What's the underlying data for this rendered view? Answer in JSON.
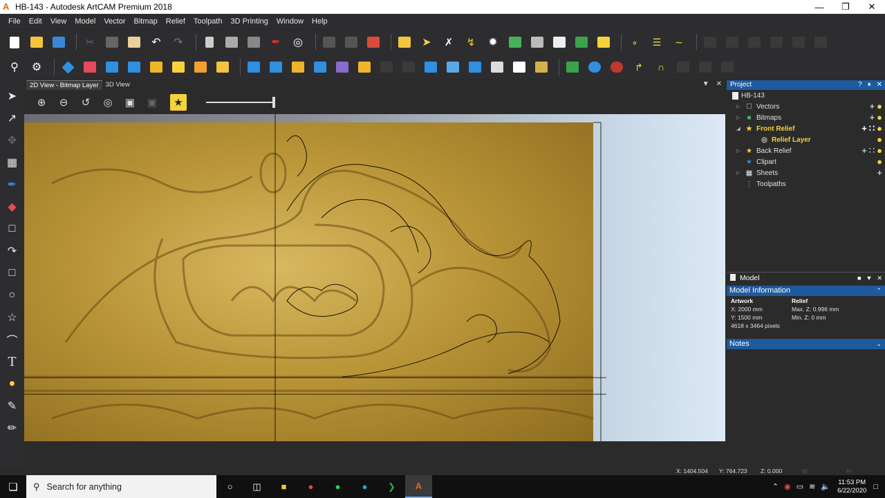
{
  "window": {
    "title": "HB-143 - Autodesk ArtCAM Premium 2018",
    "app_icon": "artcam-logo-icon"
  },
  "menu": [
    "File",
    "Edit",
    "View",
    "Model",
    "Vector",
    "Bitmap",
    "Relief",
    "Toolpath",
    "3D Printing",
    "Window",
    "Help"
  ],
  "view_tabs": [
    "2D View - Bitmap Layer",
    "3D View"
  ],
  "project": {
    "header": "Project",
    "root": "HB-143",
    "items": [
      {
        "label": "Vectors",
        "icon": "vectors-icon",
        "highlight": false
      },
      {
        "label": "Bitmaps",
        "icon": "bitmaps-icon",
        "highlight": false
      },
      {
        "label": "Front Relief",
        "icon": "star-icon",
        "highlight": true
      },
      {
        "label": "Relief Layer",
        "icon": "relief-layer-icon",
        "highlight": true
      },
      {
        "label": "Back Relief",
        "icon": "star-icon",
        "highlight": false
      },
      {
        "label": "Clipart",
        "icon": "clipart-icon",
        "highlight": false
      },
      {
        "label": "Sheets",
        "icon": "sheets-icon",
        "highlight": false
      },
      {
        "label": "Toolpaths",
        "icon": "toolpaths-icon",
        "highlight": false
      }
    ]
  },
  "model_panel": {
    "header": "Model",
    "info_title": "Model Information",
    "artwork_label": "Artwork",
    "relief_label": "Relief",
    "artwork_x": "X: 2000 mm",
    "artwork_y": "Y: 1500 mm",
    "artwork_pixels": "4618 x 3464 pixels",
    "relief_max_z": "Max. Z: 0.996 mm",
    "relief_min_z": "Min. Z: 0 mm",
    "notes_title": "Notes"
  },
  "status": {
    "x": "X: 1404.504",
    "y": "Y: 764.723",
    "z": "Z: 0.000",
    "w": "W:",
    "h": "H:"
  },
  "taskbar": {
    "search_placeholder": "Search for anything",
    "time": "11:53 PM",
    "date": "6/22/2020"
  },
  "colors": {
    "accent_blue": "#1e5a9e",
    "highlight_yellow": "#f5d23c",
    "relief_gold": "#b99537"
  }
}
